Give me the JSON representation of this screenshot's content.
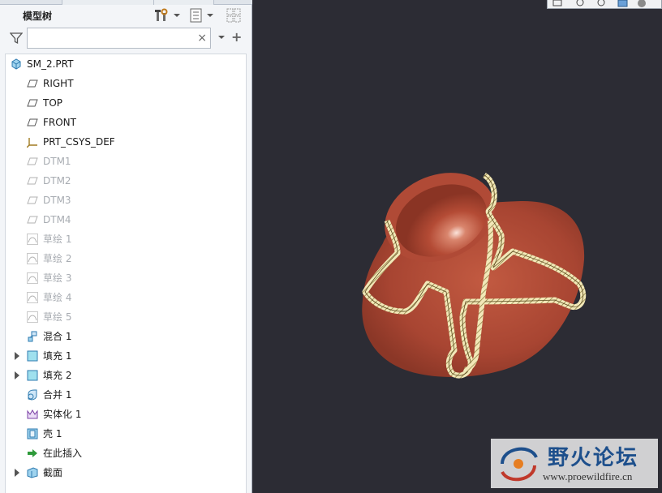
{
  "panel": {
    "title": "模型树",
    "search": {
      "value": "",
      "clear_symbol": "×"
    },
    "add_symbol": "+"
  },
  "tree": {
    "items": [
      {
        "label": "SM_2.PRT",
        "icon": "part-icon",
        "dim": false,
        "expandable": false
      },
      {
        "label": "RIGHT",
        "icon": "datum-plane-icon",
        "dim": false,
        "expandable": false
      },
      {
        "label": "TOP",
        "icon": "datum-plane-icon",
        "dim": false,
        "expandable": false
      },
      {
        "label": "FRONT",
        "icon": "datum-plane-icon",
        "dim": false,
        "expandable": false
      },
      {
        "label": "PRT_CSYS_DEF",
        "icon": "coordinate-system-icon",
        "dim": false,
        "expandable": false
      },
      {
        "label": "DTM1",
        "icon": "datum-plane-icon",
        "dim": true,
        "expandable": false
      },
      {
        "label": "DTM2",
        "icon": "datum-plane-icon",
        "dim": true,
        "expandable": false
      },
      {
        "label": "DTM3",
        "icon": "datum-plane-icon",
        "dim": true,
        "expandable": false
      },
      {
        "label": "DTM4",
        "icon": "datum-plane-icon",
        "dim": true,
        "expandable": false
      },
      {
        "label": "草绘 1",
        "icon": "sketch-icon",
        "dim": true,
        "expandable": false
      },
      {
        "label": "草绘 2",
        "icon": "sketch-icon",
        "dim": true,
        "expandable": false
      },
      {
        "label": "草绘 3",
        "icon": "sketch-icon",
        "dim": true,
        "expandable": false
      },
      {
        "label": "草绘 4",
        "icon": "sketch-icon",
        "dim": true,
        "expandable": false
      },
      {
        "label": "草绘 5",
        "icon": "sketch-icon",
        "dim": true,
        "expandable": false
      },
      {
        "label": "混合 1",
        "icon": "blend-icon",
        "dim": false,
        "expandable": false
      },
      {
        "label": "填充 1",
        "icon": "fill-icon",
        "dim": false,
        "expandable": true
      },
      {
        "label": "填充 2",
        "icon": "fill-icon",
        "dim": false,
        "expandable": true
      },
      {
        "label": "合并 1",
        "icon": "merge-icon",
        "dim": false,
        "expandable": false
      },
      {
        "label": "实体化 1",
        "icon": "solidify-icon",
        "dim": false,
        "expandable": false
      },
      {
        "label": "壳 1",
        "icon": "shell-icon",
        "dim": false,
        "expandable": false
      },
      {
        "label": "在此插入",
        "icon": "insert-here-icon",
        "dim": false,
        "expandable": false
      },
      {
        "label": "截面",
        "icon": "section-icon",
        "dim": false,
        "expandable": true
      }
    ]
  },
  "viewport": {
    "background": "#2c2c34",
    "model_color": "#b8503a",
    "section_hatch_color": "#e8d9a0"
  },
  "watermark": {
    "title": "野火论坛",
    "url": "www.proewildfire.cn"
  }
}
